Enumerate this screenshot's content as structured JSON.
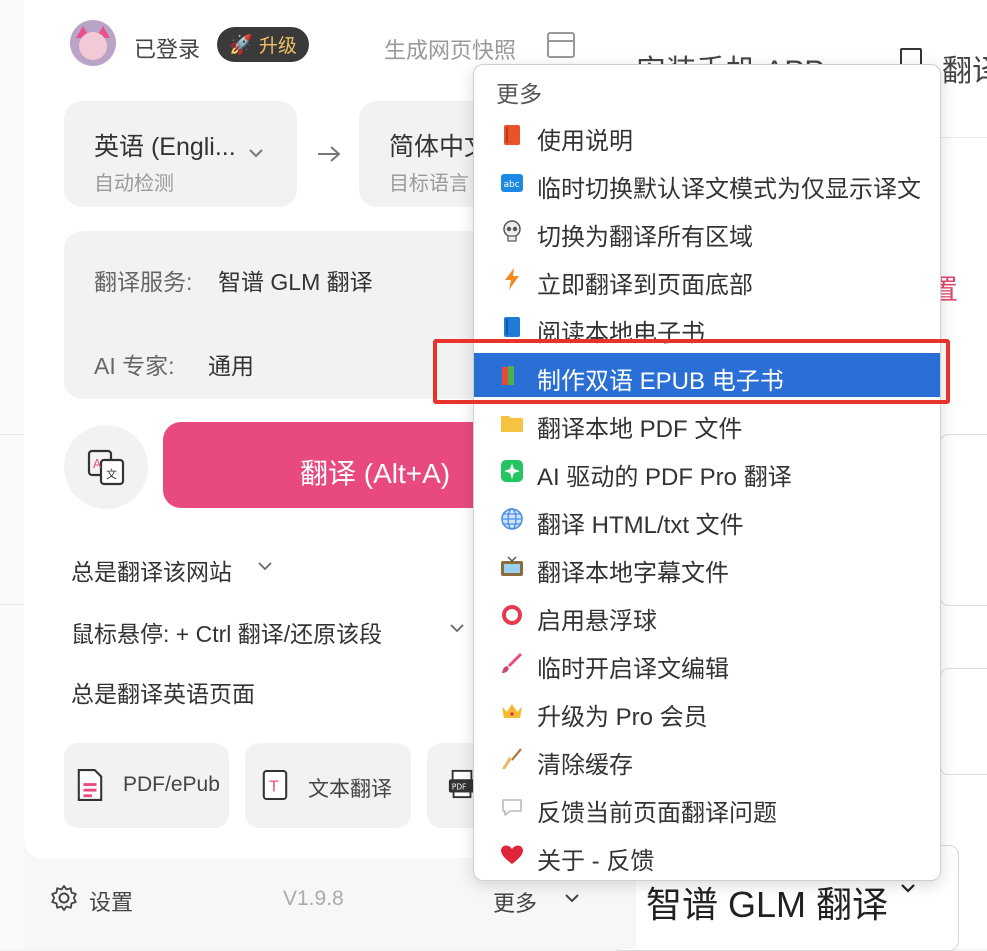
{
  "background": {
    "header_text_1": "安装手机 APP",
    "header_text_2": "翻译",
    "partial_red_text": "置",
    "bottom_select_value": "智谱 GLM 翻译"
  },
  "popup": {
    "login_status": "已登录",
    "upgrade_label": "升级",
    "snapshot_label": "生成网页快照",
    "source_lang": {
      "name": "英语 (Engli...",
      "sub": "自动检测"
    },
    "target_lang": {
      "name": "简体中文",
      "sub": "目标语言"
    },
    "service": {
      "label": "翻译服务:",
      "value": "智谱 GLM 翻译"
    },
    "ai_expert": {
      "label": "AI 专家:",
      "value": "通用"
    },
    "translate_button": "翻译 (Alt+A)",
    "options": {
      "always_site": "总是翻译该网站",
      "hover": "鼠标悬停:  + Ctrl 翻译/还原该段",
      "always_lang": "总是翻译英语页面"
    },
    "tools": [
      {
        "label": "PDF/ePub",
        "icon": "pdf-file-icon"
      },
      {
        "label": "文本翻译",
        "icon": "text-translate-icon"
      },
      {
        "label": "",
        "icon": "pdf-printer-icon"
      }
    ],
    "footer": {
      "settings": "设置",
      "version": "V1.9.8",
      "more": "更多"
    }
  },
  "menu": {
    "title": "更多",
    "items": [
      {
        "label": "使用说明",
        "icon": "manual-book-icon",
        "color": "#e8532c"
      },
      {
        "label": "临时切换默认译文模式为仅显示译文",
        "icon": "abc-icon",
        "color": "#1e88e5"
      },
      {
        "label": "切换为翻译所有区域",
        "icon": "skull-icon",
        "color": "#555555"
      },
      {
        "label": "立即翻译到页面底部",
        "icon": "lightning-icon",
        "color": "#f28b24"
      },
      {
        "label": "阅读本地电子书",
        "icon": "blue-book-icon",
        "color": "#1e7bd6"
      },
      {
        "label": "制作双语 EPUB 电子书",
        "icon": "books-icon",
        "color": "#4caf50",
        "active": true
      },
      {
        "label": "翻译本地 PDF 文件",
        "icon": "folder-icon",
        "color": "#f5c242"
      },
      {
        "label": "AI 驱动的 PDF Pro 翻译",
        "icon": "sparkle-icon",
        "color": "#22c55e"
      },
      {
        "label": "翻译 HTML/txt 文件",
        "icon": "globe-icon",
        "color": "#4a90e2"
      },
      {
        "label": "翻译本地字幕文件",
        "icon": "tv-icon",
        "color": "#8a6d3b"
      },
      {
        "label": "启用悬浮球",
        "icon": "ring-icon",
        "color": "#e53950"
      },
      {
        "label": "临时开启译文编辑",
        "icon": "brush-icon",
        "color": "#e84a80"
      },
      {
        "label": "升级为 Pro 会员",
        "icon": "crown-icon",
        "color": "#f5b82e"
      },
      {
        "label": "清除缓存",
        "icon": "broom-icon",
        "color": "#b07a3a"
      },
      {
        "label": "反馈当前页面翻译问题",
        "icon": "speech-bubble-icon",
        "color": "#bbbbbb"
      },
      {
        "label": "关于 - 反馈",
        "icon": "heart-icon",
        "color": "#e0243a"
      }
    ]
  }
}
